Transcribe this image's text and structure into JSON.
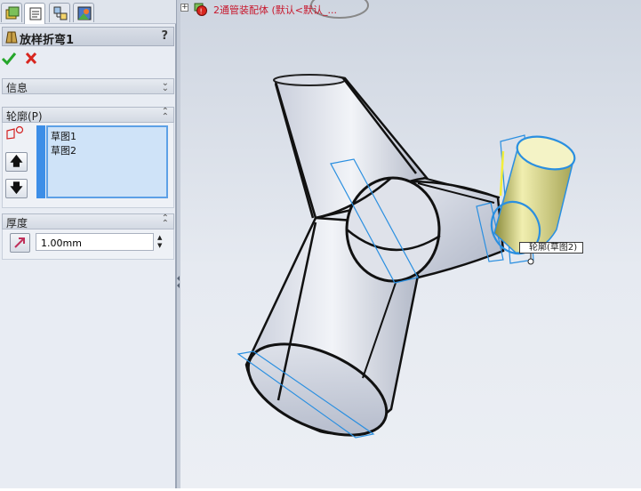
{
  "feature_manager": {
    "tabs": [
      {
        "name": "featuremanager-tab",
        "icon": "feature-tree-icon"
      },
      {
        "name": "propertymanager-tab",
        "icon": "property-manager-icon"
      },
      {
        "name": "configurationmanager-tab",
        "icon": "configuration-manager-icon"
      },
      {
        "name": "display-manager-tab",
        "icon": "display-manager-icon"
      }
    ]
  },
  "property_manager": {
    "title": "放样折弯1",
    "help": "?",
    "groups": {
      "info": {
        "label": "信息"
      },
      "profiles": {
        "label": "轮廓(P)",
        "items": [
          "草图1",
          "草图2"
        ]
      },
      "thickness": {
        "label": "厚度",
        "value": "1.00mm"
      }
    }
  },
  "viewport": {
    "tree_expander": "+",
    "tree_label": "2通管装配体 (默认<默认_...",
    "callout": "轮廓(草图2)"
  },
  "colors": {
    "accent": "#3d8ee7",
    "tree_label": "#c8172c",
    "sketch_lines": "#2a8fe0",
    "selected_face": "#d9d77a"
  }
}
